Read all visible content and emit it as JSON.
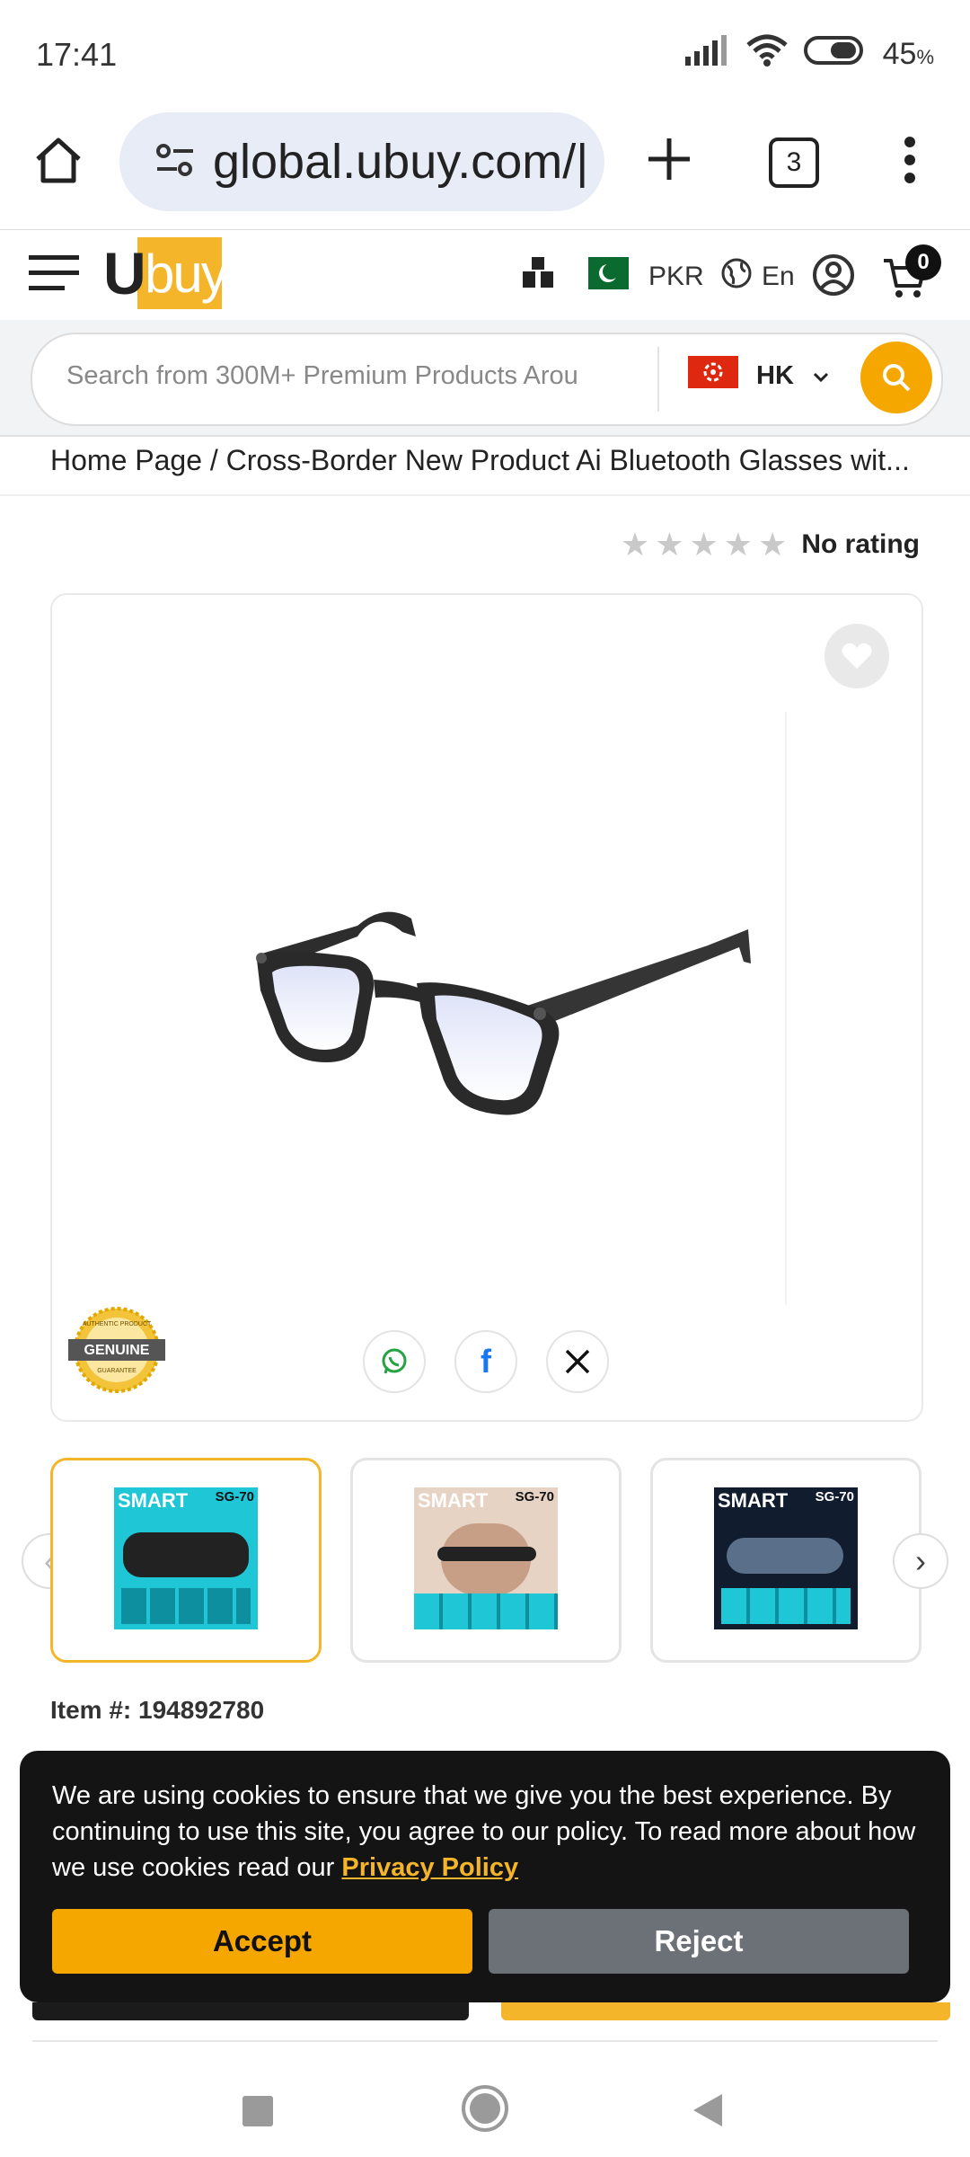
{
  "status_bar": {
    "time": "17:41",
    "battery": "45",
    "battery_suffix": "%"
  },
  "browser": {
    "url": "global.ubuy.com/|",
    "tab_count": "3"
  },
  "header": {
    "logo_letter": "U",
    "logo_rest": "buy",
    "currency": "PKR",
    "language": "En",
    "cart_count": "0",
    "brand_color": "#f5b52a"
  },
  "search": {
    "placeholder": "Search from 300M+ Premium Products Arou",
    "region": "HK"
  },
  "breadcrumb": {
    "home": "Home Page",
    "separator": "/",
    "current": "Cross-Border New Product Ai Bluetooth Glasses wit..."
  },
  "rating": {
    "stars": 0,
    "max": 5,
    "label": "No rating"
  },
  "product": {
    "genuine_badge": "GENUINE",
    "badge_top": "AUTHENTIC PRODUCT",
    "badge_bottom": "GUARANTEE",
    "item_label": "Item #:",
    "item_number": "194892780",
    "share_icons": [
      "whatsapp-icon",
      "facebook-icon",
      "x-icon"
    ]
  },
  "thumbnails": [
    {
      "title": "SMART",
      "model": "SG-70"
    },
    {
      "title": "SMART",
      "model": "SG-70"
    },
    {
      "title": "SMART",
      "model": "SG-70"
    }
  ],
  "cookie": {
    "message": "We are using cookies to ensure that we give you the best experience. By continuing to use this site, you agree to our policy. To read more about how we use cookies read our ",
    "policy_link": "Privacy Policy",
    "accept": "Accept",
    "reject": "Reject"
  }
}
